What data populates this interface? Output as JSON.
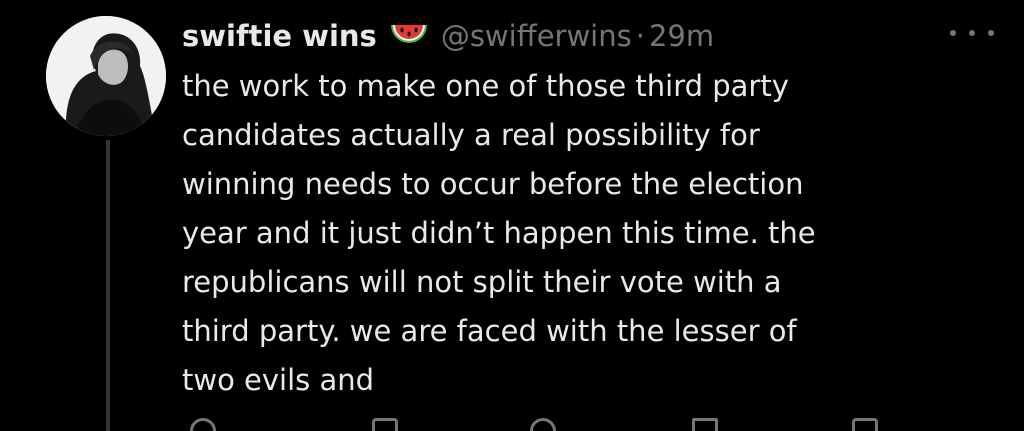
{
  "tweet": {
    "display_name": "swiftie wins",
    "badge_icon": "watermelon-emoji",
    "handle": "@swifferwins",
    "separator": "·",
    "time": "29m",
    "more_icon": "ellipsis-icon",
    "body_lines": [
      "the work to make one of those third party",
      "candidates actually a real possibility for",
      "winning needs to occur before the election",
      "year and it just didn’t happen this time. the",
      "republicans will not split their vote with a",
      "third party. we are faced with the lesser of",
      "two evils and"
    ]
  },
  "colors": {
    "background": "#000000",
    "primary_text": "#e7e9ea",
    "secondary_text": "#71767b",
    "thread_line": "#333639"
  },
  "action_icons": [
    "reply-icon",
    "retweet-icon",
    "like-icon",
    "views-icon",
    "bookmark-icon"
  ]
}
